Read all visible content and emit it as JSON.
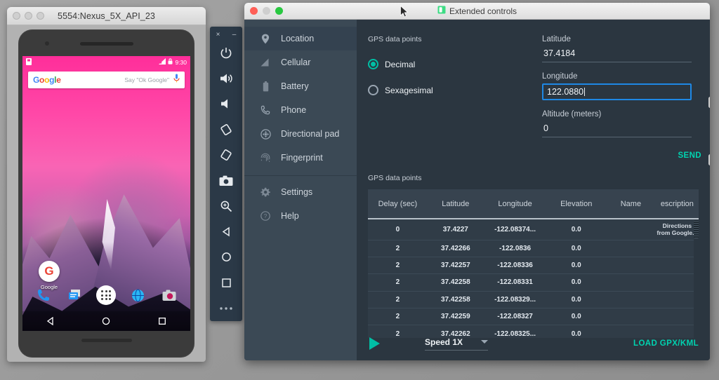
{
  "emulator_window": {
    "title": "5554:Nexus_5X_API_23",
    "phone": {
      "status_time": "9:30",
      "status_icons": [
        "sim-icon",
        "signal-icon",
        "lock-icon"
      ],
      "search_hint": "Say \"Ok Google\"",
      "google_logo": {
        "g": "G",
        "o1": "o",
        "o2": "o",
        "g2": "g",
        "l": "l",
        "e": "e"
      },
      "mic_icon": "microphone-icon",
      "app_label": "Google",
      "dock_icons": [
        "phone-icon",
        "messages-icon",
        "apps-drawer-icon",
        "browser-icon",
        "camera-icon"
      ],
      "nav_icons": [
        "back-icon",
        "home-icon",
        "overview-icon"
      ]
    }
  },
  "toolbar": {
    "close_label": "×",
    "minimize_label": "–",
    "buttons": [
      {
        "name": "power-icon"
      },
      {
        "name": "volume-up-icon"
      },
      {
        "name": "volume-down-icon"
      },
      {
        "name": "rotate-left-icon"
      },
      {
        "name": "rotate-right-icon"
      },
      {
        "name": "camera-icon"
      },
      {
        "name": "zoom-icon"
      },
      {
        "name": "back-icon"
      },
      {
        "name": "home-icon"
      },
      {
        "name": "overview-icon"
      },
      {
        "name": "more-icon"
      }
    ]
  },
  "extended_controls": {
    "window_title": "Extended controls",
    "window_icon": "extended-controls-icon",
    "sidebar": {
      "items": [
        {
          "label": "Location",
          "icon": "location-pin-icon",
          "selected": true
        },
        {
          "label": "Cellular",
          "icon": "cellular-signal-icon",
          "selected": false
        },
        {
          "label": "Battery",
          "icon": "battery-icon",
          "selected": false
        },
        {
          "label": "Phone",
          "icon": "phone-icon",
          "selected": false
        },
        {
          "label": "Directional pad",
          "icon": "dpad-icon",
          "selected": false
        },
        {
          "label": "Fingerprint",
          "icon": "fingerprint-icon",
          "selected": false
        }
      ],
      "footer_items": [
        {
          "label": "Settings",
          "icon": "gear-icon"
        },
        {
          "label": "Help",
          "icon": "help-circle-icon"
        }
      ]
    },
    "gps_section": {
      "heading": "GPS data points",
      "format_options": [
        {
          "label": "Decimal",
          "selected": true
        },
        {
          "label": "Sexagesimal",
          "selected": false
        }
      ],
      "latitude": {
        "label": "Latitude",
        "value": "37.4184"
      },
      "longitude": {
        "label": "Longitude",
        "value": "122.0880",
        "focused": true
      },
      "altitude": {
        "label": "Altitude (meters)",
        "value": "0"
      },
      "send_label": "SEND"
    },
    "table_section": {
      "heading": "GPS data points",
      "columns": [
        "Delay (sec)",
        "Latitude",
        "Longitude",
        "Elevation",
        "Name",
        "escription"
      ],
      "rows": [
        {
          "delay": "0",
          "latitude": "37.4227",
          "longitude": "-122.08374...",
          "elevation": "0.0",
          "name": "",
          "description": "Directions from Google..."
        },
        {
          "delay": "2",
          "latitude": "37.42266",
          "longitude": "-122.0836",
          "elevation": "0.0",
          "name": "",
          "description": ""
        },
        {
          "delay": "2",
          "latitude": "37.42257",
          "longitude": "-122.08336",
          "elevation": "0.0",
          "name": "",
          "description": ""
        },
        {
          "delay": "2",
          "latitude": "37.42258",
          "longitude": "-122.08331",
          "elevation": "0.0",
          "name": "",
          "description": ""
        },
        {
          "delay": "2",
          "latitude": "37.42258",
          "longitude": "-122.08329...",
          "elevation": "0.0",
          "name": "",
          "description": ""
        },
        {
          "delay": "2",
          "latitude": "37.42259",
          "longitude": "-122.08327",
          "elevation": "0.0",
          "name": "",
          "description": ""
        },
        {
          "delay": "2",
          "latitude": "37.42262",
          "longitude": "-122.08325...",
          "elevation": "0.0",
          "name": "",
          "description": ""
        }
      ]
    },
    "playback": {
      "play_icon": "play-icon",
      "speed_label": "Speed 1X",
      "load_label": "LOAD GPX/KML"
    }
  },
  "colors": {
    "accent_teal": "#00bfa5",
    "accent_teal_text": "#00d3b0",
    "focus_blue": "#1e88e5",
    "panel_bg": "#2b3640",
    "sidebar_bg": "#3b4955",
    "sidebar_selected": "#344250",
    "table_bg": "#303c47",
    "table_header_bg": "#37434f"
  }
}
